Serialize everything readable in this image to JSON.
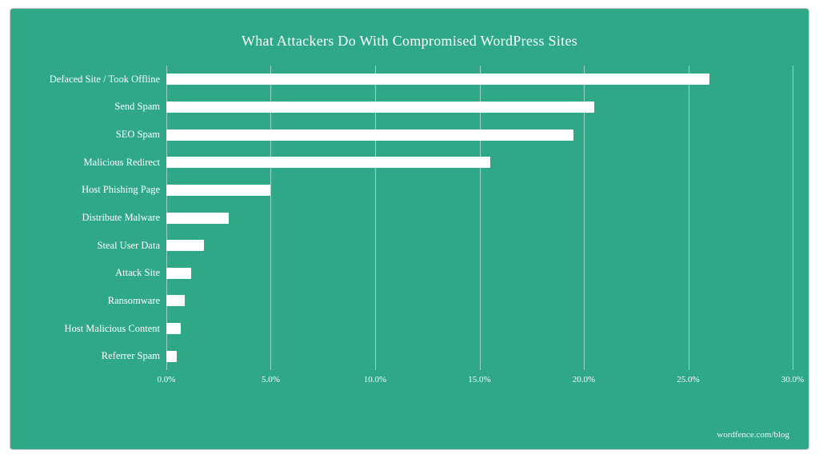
{
  "title": "What Attackers Do With Compromised WordPress Sites",
  "watermark": "wordfence.com/blog",
  "bars": [
    {
      "label": "Defaced Site / Took Offline",
      "value": 26.0
    },
    {
      "label": "Send Spam",
      "value": 20.5
    },
    {
      "label": "SEO Spam",
      "value": 19.5
    },
    {
      "label": "Malicious Redirect",
      "value": 15.5
    },
    {
      "label": "Host Phishing Page",
      "value": 5.0
    },
    {
      "label": "Distribute Malware",
      "value": 3.0
    },
    {
      "label": "Steal User Data",
      "value": 1.8
    },
    {
      "label": "Attack Site",
      "value": 1.2
    },
    {
      "label": "Ransomware",
      "value": 0.9
    },
    {
      "label": "Host Malicious Content",
      "value": 0.7
    },
    {
      "label": "Referrer Spam",
      "value": 0.5
    }
  ],
  "xAxis": {
    "max": 30,
    "ticks": [
      {
        "value": 0,
        "label": "0.0%"
      },
      {
        "value": 5,
        "label": "5.0%"
      },
      {
        "value": 10,
        "label": "10.0%"
      },
      {
        "value": 15,
        "label": "15.0%"
      },
      {
        "value": 20,
        "label": "20.0%"
      },
      {
        "value": 25,
        "label": "25.0%"
      },
      {
        "value": 30,
        "label": "30.0%"
      }
    ]
  },
  "colors": {
    "background": "#2ea887",
    "bar": "#ffffff",
    "text": "#ffffff"
  }
}
